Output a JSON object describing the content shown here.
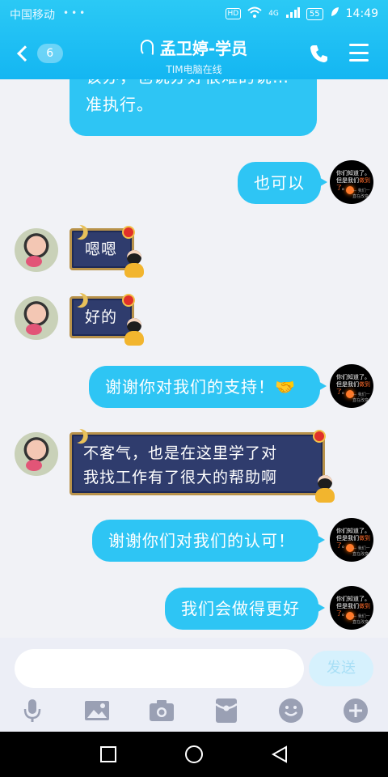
{
  "status": {
    "carrier": "中国移动",
    "dots": "•••",
    "hd": "HD",
    "signal": "4G",
    "battery": "55",
    "time": "14:49"
  },
  "header": {
    "unread_count": "6",
    "title": "孟卫婷-学员",
    "subtitle": "TIM电脑在线"
  },
  "messages": [
    {
      "side": "out",
      "text_lines": [
        "该办，也说办好很难的说…",
        "准执行。"
      ]
    },
    {
      "side": "out",
      "text": "也可以"
    },
    {
      "side": "in",
      "text": "嗯嗯"
    },
    {
      "side": "in",
      "text": "好的"
    },
    {
      "side": "out",
      "text": "谢谢你对我们的支持！🤝"
    },
    {
      "side": "in",
      "text_lines": [
        "不客气，也是在这里学了对",
        "我找工作有了很大的帮助啊"
      ]
    },
    {
      "side": "out",
      "text": "谢谢你们对我们的认可！"
    },
    {
      "side": "out",
      "text": "我们会做得更好"
    }
  ],
  "self_avatar": {
    "line1": "你们知道了。",
    "line2a": "但是我们",
    "line2b": "做到了",
    "line2c": "。",
    "signature": "— 我们一直在改变"
  },
  "input": {
    "placeholder": "",
    "value": "",
    "send_label": "发送"
  },
  "toolbar": [
    "mic-icon",
    "image-icon",
    "camera-icon",
    "red-envelope-icon",
    "emoji-icon",
    "plus-icon"
  ],
  "colors": {
    "header": "#14b6f2",
    "bubble_out": "#2ec5f4",
    "bubble_in": "#2f3c6d",
    "bubble_in_border": "#b8924a"
  }
}
